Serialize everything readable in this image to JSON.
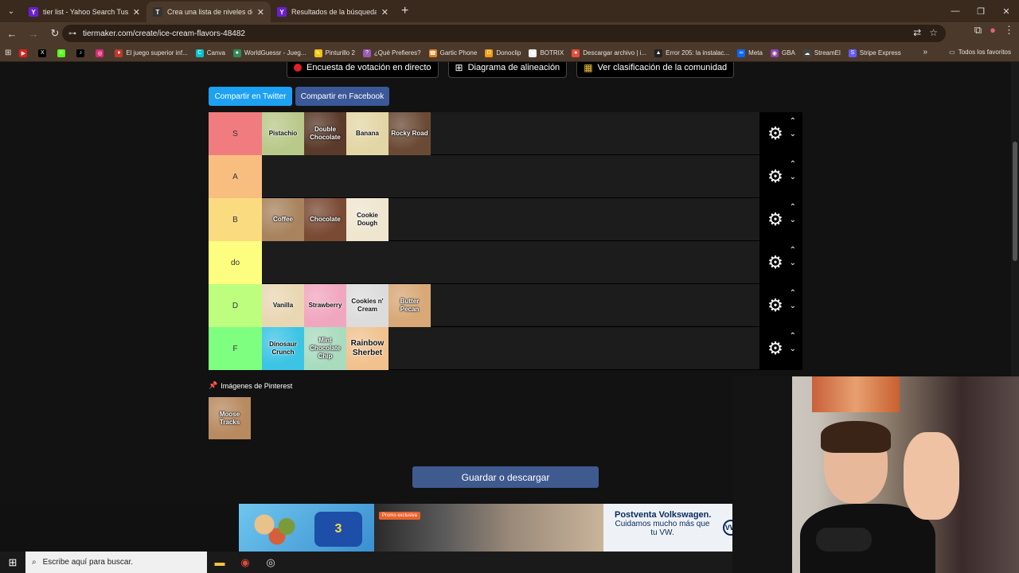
{
  "browser": {
    "tabs": [
      {
        "title": "tier list - Yahoo Search Tus resu",
        "favicon": "Y",
        "color": "#6b1fd1",
        "active": false
      },
      {
        "title": "Crea una lista de niveles de sab",
        "favicon": "T",
        "color": "#333333",
        "active": true
      },
      {
        "title": "Resultados de la búsqueda de",
        "favicon": "Y",
        "color": "#6b1fd1",
        "active": false
      }
    ],
    "url": "tiermaker.com/create/ice-cream-flavors-48482",
    "bookmarks": [
      {
        "label": "",
        "color": "#e02020",
        "icon": "▶"
      },
      {
        "label": "",
        "color": "#000000",
        "icon": "X"
      },
      {
        "label": "",
        "color": "#53fc18",
        "icon": "K"
      },
      {
        "label": "",
        "color": "#000000",
        "icon": "♪"
      },
      {
        "label": "",
        "color": "#d62976",
        "icon": "◎"
      },
      {
        "label": "El juego superior inf...",
        "color": "#c0392b",
        "icon": "♦"
      },
      {
        "label": "Canva",
        "color": "#00c4cc",
        "icon": "C"
      },
      {
        "label": "WorldGuessr - Jueg...",
        "color": "#2e8b57",
        "icon": "●"
      },
      {
        "label": "Pinturillo 2",
        "color": "#f1c40f",
        "icon": "✎"
      },
      {
        "label": "¿Qué Prefieres?",
        "color": "#9b59b6",
        "icon": "?"
      },
      {
        "label": "Gartic Phone",
        "color": "#e67e22",
        "icon": "☎"
      },
      {
        "label": "Donoclip",
        "color": "#f39c12",
        "icon": "D"
      },
      {
        "label": "BOTRIX",
        "color": "#ecf0f1",
        "icon": "◆"
      },
      {
        "label": "Descargar archivo | i...",
        "color": "#e74c3c",
        "icon": "●"
      },
      {
        "label": "Error 205: la instalac...",
        "color": "#222222",
        "icon": "▲"
      },
      {
        "label": "Meta",
        "color": "#0866ff",
        "icon": "∞"
      },
      {
        "label": "GBA",
        "color": "#8e44ad",
        "icon": "◉"
      },
      {
        "label": "StreamEl",
        "color": "#444444",
        "icon": "☁"
      },
      {
        "label": "Stripe Express",
        "color": "#635bff",
        "icon": "S"
      }
    ],
    "bookmarks_all": "Todos los favoritos"
  },
  "page": {
    "top_buttons": [
      {
        "label": "Encuesta de votación en directo",
        "icon": "record-icon"
      },
      {
        "label": "Diagrama de alineación",
        "icon": "grid-icon"
      },
      {
        "label": "Ver clasificación de la comunidad",
        "icon": "color-grid-icon"
      }
    ],
    "share_twitter": "Compartir en Twitter",
    "share_facebook": "Compartir en Facebook",
    "tiers": [
      {
        "label": "S",
        "color": "#f07c7f",
        "items": [
          {
            "name": "Pistachio",
            "bg": "#b9c98a",
            "light": false
          },
          {
            "name": "Double Chocolate",
            "bg": "#5a3a2a",
            "light": true
          },
          {
            "name": "Banana",
            "bg": "#e3d6a6",
            "light": false
          },
          {
            "name": "Rocky Road",
            "bg": "#6b4a35",
            "light": true
          }
        ]
      },
      {
        "label": "A",
        "color": "#f8be80",
        "items": []
      },
      {
        "label": "B",
        "color": "#fbdb80",
        "items": [
          {
            "name": "Coffee",
            "bg": "#a9835e",
            "light": true
          },
          {
            "name": "Chocolate",
            "bg": "#7a4a34",
            "light": true
          },
          {
            "name": "Cookie Dough",
            "bg": "#efe6cf",
            "light": false
          }
        ]
      },
      {
        "label": "do",
        "color": "#fdfe7f",
        "items": []
      },
      {
        "label": "D",
        "color": "#bdfe7f",
        "items": [
          {
            "name": "Vanilla",
            "bg": "#e9d7b3",
            "light": false
          },
          {
            "name": "Strawberry",
            "bg": "#f1a6bf",
            "light": false
          },
          {
            "name": "Cookies n' Cream",
            "bg": "#dcdcdc",
            "light": false
          },
          {
            "name": "Butter Pecan",
            "bg": "#d8a876",
            "light": true
          }
        ]
      },
      {
        "label": "F",
        "color": "#7fff7f",
        "items": [
          {
            "name": "Dinosaur Crunch",
            "bg": "#3cc4e4",
            "light": false
          },
          {
            "name": "Mint Chocolate Chip",
            "bg": "#a9dcbf",
            "light": true
          },
          {
            "name": "Rainbow Sherbet",
            "bg": "#f1c28e",
            "light": false,
            "big": true
          }
        ]
      }
    ],
    "pinterest_label": "Imágenes de Pinterest",
    "pool_items": [
      {
        "name": "Moose Tracks",
        "bg": "#b88a60",
        "light": true
      }
    ],
    "save_button": "Guardar o descargar"
  },
  "ad": {
    "promo": "Promo exclusiva",
    "toy_logo": "3",
    "vw_heading": "Postventa Volkswagen.",
    "vw_sub": "Cuidamos mucho más que tu VW.",
    "vw_logo": "VW"
  },
  "taskbar": {
    "search_placeholder": "Escribe aquí para buscar."
  }
}
